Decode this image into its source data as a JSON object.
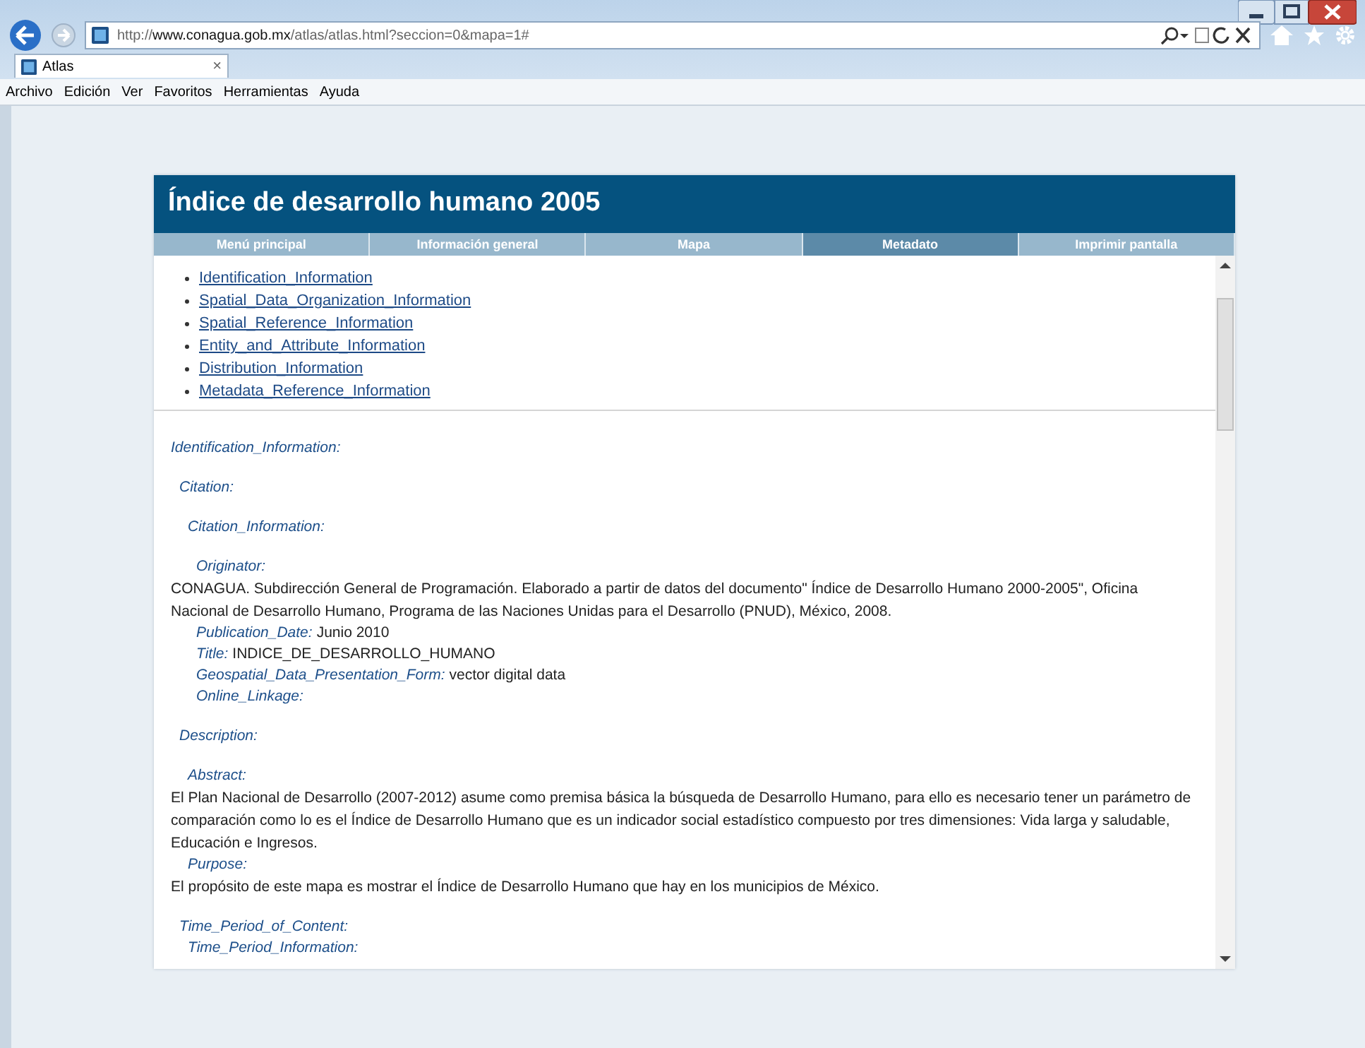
{
  "browser": {
    "url_parts": [
      {
        "text": "http://",
        "strong": false
      },
      {
        "text": "www.conagua.gob.mx",
        "strong": true
      },
      {
        "text": "/atlas/atlas.html?seccion=0&mapa=1#",
        "strong": false
      }
    ],
    "tab_title": "Atlas",
    "tab_close": "×",
    "menu": [
      "Archivo",
      "Edición",
      "Ver",
      "Favoritos",
      "Herramientas",
      "Ayuda"
    ]
  },
  "page": {
    "title": "Índice de desarrollo humano 2005",
    "tabs": [
      {
        "label": "Menú principal",
        "selected": false
      },
      {
        "label": "Información general",
        "selected": false
      },
      {
        "label": "Mapa",
        "selected": false
      },
      {
        "label": "Metadato",
        "selected": true
      },
      {
        "label": "Imprimir pantalla",
        "selected": false
      }
    ],
    "toc": [
      "Identification_Information",
      "Spatial_Data_Organization_Information",
      "Spatial_Reference_Information",
      "Entity_and_Attribute_Information",
      "Distribution_Information",
      "Metadata_Reference_Information"
    ],
    "metadata": [
      {
        "label": "Identification_Information:",
        "children": [
          {
            "label": "Citation:",
            "children": [
              {
                "label": "Citation_Information:",
                "children": [
                  {
                    "label": "Originator:",
                    "body": "CONAGUA. Subdirección General de Programación. Elaborado a partir de datos del documento\" Índice de Desarrollo Humano 2000-2005\", Oficina Nacional de Desarrollo Humano, Programa de las Naciones Unidas para el Desarrollo (PNUD), México, 2008."
                  },
                  {
                    "label": "Publication_Date:",
                    "value": "Junio 2010"
                  },
                  {
                    "label": "Title:",
                    "value": "INDICE_DE_DESARROLLO_HUMANO"
                  },
                  {
                    "label": "Geospatial_Data_Presentation_Form:",
                    "value": "vector digital data"
                  },
                  {
                    "label": "Online_Linkage:"
                  }
                ]
              }
            ]
          },
          {
            "label": "Description:",
            "children": [
              {
                "label": "Abstract:",
                "body": "El Plan Nacional de Desarrollo (2007-2012) asume como premisa básica la búsqueda de Desarrollo Humano, para ello es necesario tener un parámetro de comparación como lo es el Índice de Desarrollo Humano que es un indicador social estadístico compuesto por tres dimensiones: Vida larga y saludable, Educación e Ingresos."
              },
              {
                "label": "Purpose:",
                "body": "El propósito de este mapa es mostrar el Índice de Desarrollo Humano que hay en los municipios de México."
              }
            ]
          },
          {
            "label": "Time_Period_of_Content:",
            "children": [
              {
                "label": "Time_Period_Information:"
              }
            ]
          }
        ]
      }
    ]
  }
}
